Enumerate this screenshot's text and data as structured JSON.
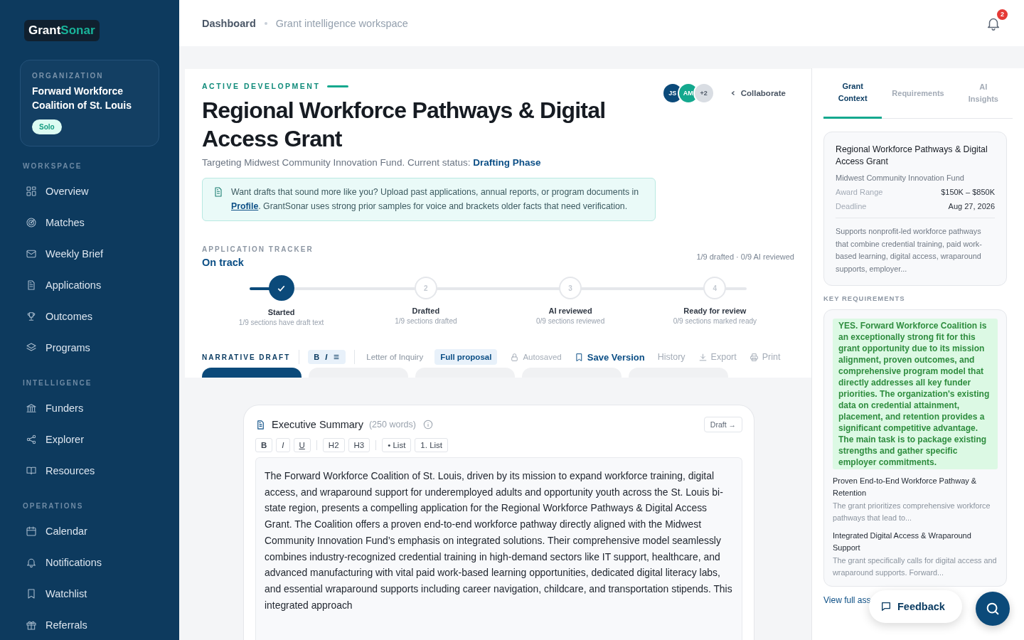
{
  "logo": {
    "part1": "Grant",
    "part2": "Sonar"
  },
  "organization": {
    "label": "ORGANIZATION",
    "name": "Forward Workforce Coalition of St. Louis",
    "badge": "Solo"
  },
  "sidebar": {
    "sections": [
      {
        "title": "WORKSPACE",
        "items": [
          {
            "label": "Overview"
          },
          {
            "label": "Matches"
          },
          {
            "label": "Weekly Brief"
          },
          {
            "label": "Applications"
          },
          {
            "label": "Outcomes"
          },
          {
            "label": "Programs"
          }
        ]
      },
      {
        "title": "INTELLIGENCE",
        "items": [
          {
            "label": "Funders"
          },
          {
            "label": "Explorer"
          },
          {
            "label": "Resources"
          }
        ]
      },
      {
        "title": "OPERATIONS",
        "items": [
          {
            "label": "Calendar"
          },
          {
            "label": "Notifications"
          },
          {
            "label": "Watchlist"
          },
          {
            "label": "Referrals"
          }
        ]
      }
    ]
  },
  "breadcrumb": [
    "Dashboard",
    "Grant intelligence workspace"
  ],
  "notifications": {
    "count": "2"
  },
  "header": {
    "eyebrow": "ACTIVE DEVELOPMENT",
    "title": "Regional Workforce Pathways & Digital Access Grant",
    "subtitle": "Targeting Midwest Community Innovation Fund. Current status:",
    "status": "Drafting Phase"
  },
  "collaborators": [
    {
      "initials": "JS",
      "color": "#0b4a7a"
    },
    {
      "initials": "AM",
      "color": "#14a88e"
    },
    {
      "initials": "+2",
      "color": "#d9dde3"
    }
  ],
  "collaborate": "Collaborate",
  "notice": {
    "before": "Want drafts that sound more like you? Upload past applications, annual reports, or program documents in",
    "link": "Profile",
    "after": ". GrantSonar uses strong prior samples for voice and brackets older facts that need verification."
  },
  "tracker": {
    "label": "APPLICATION TRACKER",
    "status": "On track",
    "summary": "1/9 drafted · 0/9 AI reviewed",
    "level": 0.05,
    "steps": [
      {
        "done": true,
        "title": "Started",
        "detail": "1/9 sections have draft text"
      },
      {
        "number": "2",
        "done": false,
        "title": "Drafted",
        "detail": "1/9 sections drafted"
      },
      {
        "number": "3",
        "done": false,
        "title": "AI reviewed",
        "detail": "0/9 sections reviewed"
      },
      {
        "number": "4",
        "done": false,
        "title": "Ready for review",
        "detail": "0/9 sections marked ready"
      }
    ]
  },
  "toolbar": {
    "label": "NARRATIVE DRAFT",
    "format": [
      "B",
      "I"
    ],
    "modes": [
      {
        "label": "Letter of Inquiry",
        "selected": false
      },
      {
        "label": "Full proposal",
        "selected": true
      }
    ],
    "actions": [
      {
        "label": "Autosaved",
        "kind": "status"
      },
      {
        "label": "Save Version",
        "kind": "primary"
      },
      {
        "label": "History",
        "kind": "muted"
      },
      {
        "label": "Export",
        "kind": "muted"
      },
      {
        "label": "Print",
        "kind": "muted"
      }
    ]
  },
  "section_tabs": [
    {
      "selected": true
    },
    {
      "selected": false
    },
    {
      "selected": false
    },
    {
      "selected": false
    },
    {
      "selected": false
    }
  ],
  "editor": {
    "title": "Executive Summary",
    "word_count": "(250 words)",
    "status_button": "Draft →",
    "tools": [
      [
        "B",
        "I",
        "U"
      ],
      [
        "H2",
        "H3"
      ],
      [
        "• List",
        "1. List"
      ]
    ],
    "text": "The Forward Workforce Coalition of St. Louis, driven by its mission to expand workforce training, digital access, and wraparound support for underemployed adults and opportunity youth across the St. Louis bi-state region, presents a compelling application for the Regional Workforce Pathways & Digital Access Grant. The Coalition offers a proven end-to-end workforce pathway directly aligned with the Midwest Community Innovation Fund’s emphasis on integrated solutions. Their comprehensive model seamlessly combines industry-recognized credential training in high-demand sectors like IT support, healthcare, and advanced manufacturing with vital paid work-based learning opportunities, dedicated digital literacy labs, and essential wraparound supports including career navigation, childcare, and transportation stipends. This integrated approach"
  },
  "panel": {
    "tabs": [
      {
        "label": "Grant Context",
        "selected": true
      },
      {
        "label": "Requirements",
        "selected": false
      },
      {
        "label": "AI Insights",
        "selected": false
      }
    ],
    "grant": {
      "title": "Regional Workforce Pathways & Digital Access Grant",
      "funder": "Midwest Community Innovation Fund",
      "facts": [
        {
          "label": "Award Range",
          "value": "$150K – $850K"
        },
        {
          "label": "Deadline",
          "value": "Aug 27, 2026"
        }
      ],
      "description": "Supports nonprofit-led workforce pathways that combine credential training, paid work-based learning, digital access, wraparound supports, employer..."
    },
    "requirements_label": "KEY REQUIREMENTS",
    "verdict": "YES. Forward Workforce Coalition is an exceptionally strong fit for this grant opportunity due to its mission alignment, proven outcomes, and comprehensive program model that directly addresses all key funder priorities. The organization's existing data on credential attainment, placement, and retention provides a significant competitive advantage. The main task is to package existing strengths and gather specific employer commitments.",
    "requirements": [
      {
        "title": "Proven End-to-End Workforce Pathway & Retention",
        "text": "The grant prioritizes comprehensive workforce pathways that lead to..."
      },
      {
        "title": "Integrated Digital Access & Wraparound Support",
        "text": "The grant specifically calls for digital access and wraparound supports. Forward..."
      }
    ],
    "link": "View full ass"
  },
  "feedback": "Feedback"
}
